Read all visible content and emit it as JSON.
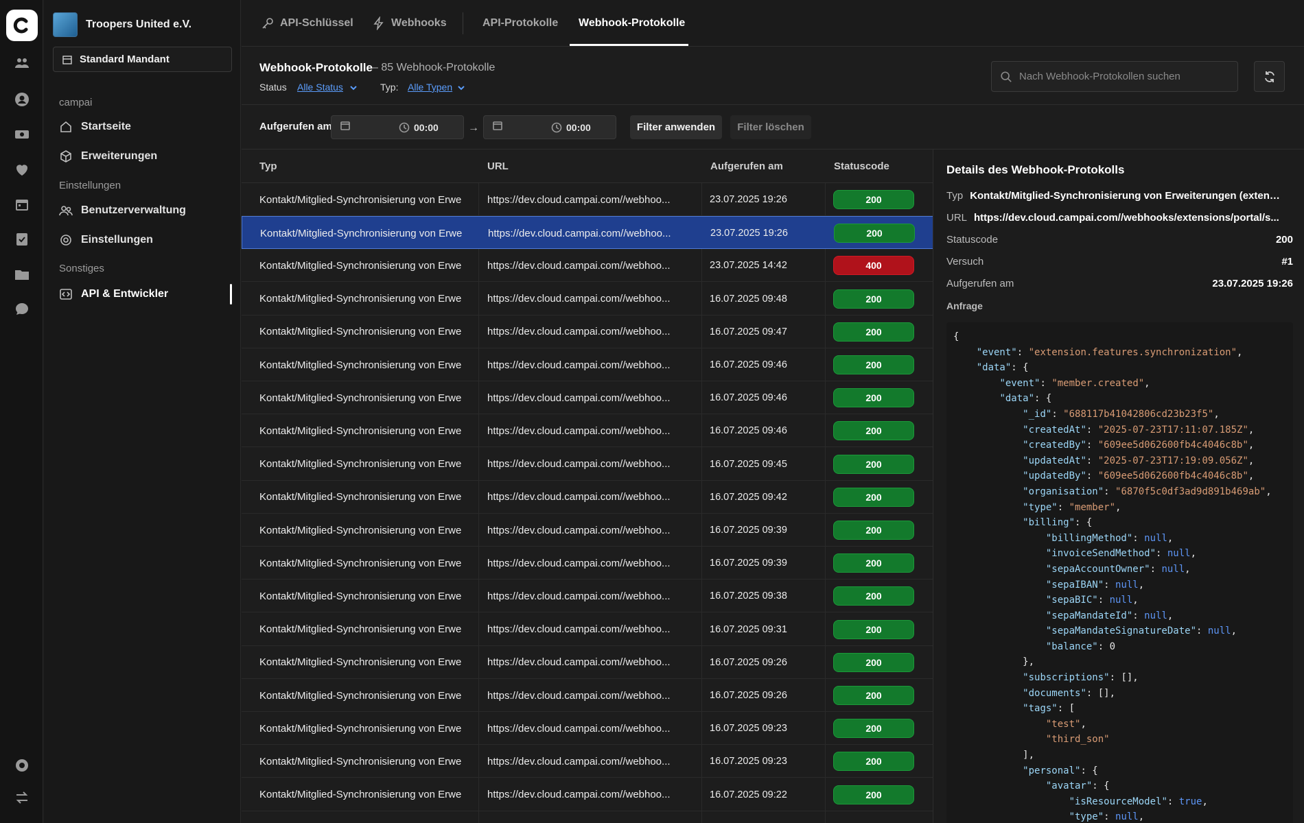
{
  "rail": {
    "items": [
      "logo",
      "members",
      "profile",
      "finance",
      "donations",
      "calendar",
      "tasks",
      "files",
      "chat",
      "settings",
      "switch"
    ]
  },
  "sidebar": {
    "org_name": "Troopers United e.V.",
    "tenant": "Standard Mandant",
    "sections": [
      {
        "label": "campai",
        "items": [
          "Startseite",
          "Erweiterungen"
        ]
      },
      {
        "label": "Einstellungen",
        "items": [
          "Benutzerverwaltung",
          "Einstellungen"
        ]
      },
      {
        "label": "Sonstiges",
        "items": [
          "API & Entwickler"
        ]
      }
    ]
  },
  "tabs": [
    {
      "label": "API-Schlüssel"
    },
    {
      "label": "Webhooks"
    },
    {
      "label": "API-Protokolle"
    },
    {
      "label": "Webhook-Protokolle",
      "active": true
    }
  ],
  "header": {
    "title": "Webhook-Protokolle",
    "count": "– 85 Webhook-Protokolle",
    "status_label": "Status",
    "status_value": "Alle Status",
    "type_label": "Typ:",
    "type_value": "Alle Typen",
    "search_placeholder": "Nach Webhook-Protokollen suchen"
  },
  "datebar": {
    "label": "Aufgerufen am",
    "from_time": "00:00",
    "to_time": "00:00",
    "arrow": "→",
    "apply": "Filter anwenden",
    "clear": "Filter löschen"
  },
  "table": {
    "columns": [
      "Typ",
      "URL",
      "Aufgerufen am",
      "Statuscode"
    ],
    "rows": [
      {
        "type": "Kontakt/Mitglied-Synchronisierung von Erwe",
        "url": "https://dev.cloud.campai.com//webhoo...",
        "date": "23.07.2025 19:26",
        "code": "200"
      },
      {
        "type": "Kontakt/Mitglied-Synchronisierung von Erwe",
        "url": "https://dev.cloud.campai.com//webhoo...",
        "date": "23.07.2025 19:26",
        "code": "200",
        "selected": true
      },
      {
        "type": "Kontakt/Mitglied-Synchronisierung von Erwe",
        "url": "https://dev.cloud.campai.com//webhoo...",
        "date": "23.07.2025 14:42",
        "code": "400"
      },
      {
        "type": "Kontakt/Mitglied-Synchronisierung von Erwe",
        "url": "https://dev.cloud.campai.com//webhoo...",
        "date": "16.07.2025 09:48",
        "code": "200"
      },
      {
        "type": "Kontakt/Mitglied-Synchronisierung von Erwe",
        "url": "https://dev.cloud.campai.com//webhoo...",
        "date": "16.07.2025 09:47",
        "code": "200"
      },
      {
        "type": "Kontakt/Mitglied-Synchronisierung von Erwe",
        "url": "https://dev.cloud.campai.com//webhoo...",
        "date": "16.07.2025 09:46",
        "code": "200"
      },
      {
        "type": "Kontakt/Mitglied-Synchronisierung von Erwe",
        "url": "https://dev.cloud.campai.com//webhoo...",
        "date": "16.07.2025 09:46",
        "code": "200"
      },
      {
        "type": "Kontakt/Mitglied-Synchronisierung von Erwe",
        "url": "https://dev.cloud.campai.com//webhoo...",
        "date": "16.07.2025 09:46",
        "code": "200"
      },
      {
        "type": "Kontakt/Mitglied-Synchronisierung von Erwe",
        "url": "https://dev.cloud.campai.com//webhoo...",
        "date": "16.07.2025 09:45",
        "code": "200"
      },
      {
        "type": "Kontakt/Mitglied-Synchronisierung von Erwe",
        "url": "https://dev.cloud.campai.com//webhoo...",
        "date": "16.07.2025 09:42",
        "code": "200"
      },
      {
        "type": "Kontakt/Mitglied-Synchronisierung von Erwe",
        "url": "https://dev.cloud.campai.com//webhoo...",
        "date": "16.07.2025 09:39",
        "code": "200"
      },
      {
        "type": "Kontakt/Mitglied-Synchronisierung von Erwe",
        "url": "https://dev.cloud.campai.com//webhoo...",
        "date": "16.07.2025 09:39",
        "code": "200"
      },
      {
        "type": "Kontakt/Mitglied-Synchronisierung von Erwe",
        "url": "https://dev.cloud.campai.com//webhoo...",
        "date": "16.07.2025 09:38",
        "code": "200"
      },
      {
        "type": "Kontakt/Mitglied-Synchronisierung von Erwe",
        "url": "https://dev.cloud.campai.com//webhoo...",
        "date": "16.07.2025 09:31",
        "code": "200"
      },
      {
        "type": "Kontakt/Mitglied-Synchronisierung von Erwe",
        "url": "https://dev.cloud.campai.com//webhoo...",
        "date": "16.07.2025 09:26",
        "code": "200"
      },
      {
        "type": "Kontakt/Mitglied-Synchronisierung von Erwe",
        "url": "https://dev.cloud.campai.com//webhoo...",
        "date": "16.07.2025 09:26",
        "code": "200"
      },
      {
        "type": "Kontakt/Mitglied-Synchronisierung von Erwe",
        "url": "https://dev.cloud.campai.com//webhoo...",
        "date": "16.07.2025 09:23",
        "code": "200"
      },
      {
        "type": "Kontakt/Mitglied-Synchronisierung von Erwe",
        "url": "https://dev.cloud.campai.com//webhoo...",
        "date": "16.07.2025 09:23",
        "code": "200"
      },
      {
        "type": "Kontakt/Mitglied-Synchronisierung von Erwe",
        "url": "https://dev.cloud.campai.com//webhoo...",
        "date": "16.07.2025 09:22",
        "code": "200"
      }
    ]
  },
  "detail": {
    "title": "Details des Webhook-Protokolls",
    "type_key": "Typ",
    "type_value": "Kontakt/Mitglied-Synchronisierung von Erweiterungen (extensi...",
    "url_key": "URL",
    "url_value": "https://dev.cloud.campai.com//webhooks/extensions/portal/s...",
    "status_key": "Statuscode",
    "status_value": "200",
    "attempt_key": "Versuch",
    "attempt_value": "#1",
    "called_key": "Aufgerufen am",
    "called_value": "23.07.2025 19:26",
    "request_label": "Anfrage",
    "code_lines": [
      [
        [
          "p",
          "{"
        ]
      ],
      [
        [
          "p",
          "    "
        ],
        [
          "k",
          "\"event\""
        ],
        [
          "p",
          ": "
        ],
        [
          "s",
          "\"extension.features.synchronization\""
        ],
        [
          "p",
          ","
        ]
      ],
      [
        [
          "p",
          "    "
        ],
        [
          "k",
          "\"data\""
        ],
        [
          "p",
          ": {"
        ]
      ],
      [
        [
          "p",
          "        "
        ],
        [
          "k",
          "\"event\""
        ],
        [
          "p",
          ": "
        ],
        [
          "s",
          "\"member.created\""
        ],
        [
          "p",
          ","
        ]
      ],
      [
        [
          "p",
          "        "
        ],
        [
          "k",
          "\"data\""
        ],
        [
          "p",
          ": {"
        ]
      ],
      [
        [
          "p",
          "            "
        ],
        [
          "k",
          "\"_id\""
        ],
        [
          "p",
          ": "
        ],
        [
          "s",
          "\"688117b41042806cd23b23f5\""
        ],
        [
          "p",
          ","
        ]
      ],
      [
        [
          "p",
          "            "
        ],
        [
          "k",
          "\"createdAt\""
        ],
        [
          "p",
          ": "
        ],
        [
          "s",
          "\"2025-07-23T17:11:07.185Z\""
        ],
        [
          "p",
          ","
        ]
      ],
      [
        [
          "p",
          "            "
        ],
        [
          "k",
          "\"createdBy\""
        ],
        [
          "p",
          ": "
        ],
        [
          "s",
          "\"609ee5d062600fb4c4046c8b\""
        ],
        [
          "p",
          ","
        ]
      ],
      [
        [
          "p",
          "            "
        ],
        [
          "k",
          "\"updatedAt\""
        ],
        [
          "p",
          ": "
        ],
        [
          "s",
          "\"2025-07-23T17:19:09.056Z\""
        ],
        [
          "p",
          ","
        ]
      ],
      [
        [
          "p",
          "            "
        ],
        [
          "k",
          "\"updatedBy\""
        ],
        [
          "p",
          ": "
        ],
        [
          "s",
          "\"609ee5d062600fb4c4046c8b\""
        ],
        [
          "p",
          ","
        ]
      ],
      [
        [
          "p",
          "            "
        ],
        [
          "k",
          "\"organisation\""
        ],
        [
          "p",
          ": "
        ],
        [
          "s",
          "\"6870f5c0df3ad9d891b469ab\""
        ],
        [
          "p",
          ","
        ]
      ],
      [
        [
          "p",
          "            "
        ],
        [
          "k",
          "\"type\""
        ],
        [
          "p",
          ": "
        ],
        [
          "s",
          "\"member\""
        ],
        [
          "p",
          ","
        ]
      ],
      [
        [
          "p",
          "            "
        ],
        [
          "k",
          "\"billing\""
        ],
        [
          "p",
          ": {"
        ]
      ],
      [
        [
          "p",
          "                "
        ],
        [
          "k",
          "\"billingMethod\""
        ],
        [
          "p",
          ": "
        ],
        [
          "n",
          "null"
        ],
        [
          "p",
          ","
        ]
      ],
      [
        [
          "p",
          "                "
        ],
        [
          "k",
          "\"invoiceSendMethod\""
        ],
        [
          "p",
          ": "
        ],
        [
          "n",
          "null"
        ],
        [
          "p",
          ","
        ]
      ],
      [
        [
          "p",
          "                "
        ],
        [
          "k",
          "\"sepaAccountOwner\""
        ],
        [
          "p",
          ": "
        ],
        [
          "n",
          "null"
        ],
        [
          "p",
          ","
        ]
      ],
      [
        [
          "p",
          "                "
        ],
        [
          "k",
          "\"sepaIBAN\""
        ],
        [
          "p",
          ": "
        ],
        [
          "n",
          "null"
        ],
        [
          "p",
          ","
        ]
      ],
      [
        [
          "p",
          "                "
        ],
        [
          "k",
          "\"sepaBIC\""
        ],
        [
          "p",
          ": "
        ],
        [
          "n",
          "null"
        ],
        [
          "p",
          ","
        ]
      ],
      [
        [
          "p",
          "                "
        ],
        [
          "k",
          "\"sepaMandateId\""
        ],
        [
          "p",
          ": "
        ],
        [
          "n",
          "null"
        ],
        [
          "p",
          ","
        ]
      ],
      [
        [
          "p",
          "                "
        ],
        [
          "k",
          "\"sepaMandateSignatureDate\""
        ],
        [
          "p",
          ": "
        ],
        [
          "n",
          "null"
        ],
        [
          "p",
          ","
        ]
      ],
      [
        [
          "p",
          "                "
        ],
        [
          "k",
          "\"balance\""
        ],
        [
          "p",
          ": 0"
        ]
      ],
      [
        [
          "p",
          "            },"
        ]
      ],
      [
        [
          "p",
          "            "
        ],
        [
          "k",
          "\"subscriptions\""
        ],
        [
          "p",
          ": [],"
        ]
      ],
      [
        [
          "p",
          "            "
        ],
        [
          "k",
          "\"documents\""
        ],
        [
          "p",
          ": [],"
        ]
      ],
      [
        [
          "p",
          "            "
        ],
        [
          "k",
          "\"tags\""
        ],
        [
          "p",
          ": ["
        ]
      ],
      [
        [
          "p",
          "                "
        ],
        [
          "s",
          "\"test\""
        ],
        [
          "p",
          ","
        ]
      ],
      [
        [
          "p",
          "                "
        ],
        [
          "s",
          "\"third_son\""
        ]
      ],
      [
        [
          "p",
          "            ],"
        ]
      ],
      [
        [
          "p",
          "            "
        ],
        [
          "k",
          "\"personal\""
        ],
        [
          "p",
          ": {"
        ]
      ],
      [
        [
          "p",
          "                "
        ],
        [
          "k",
          "\"avatar\""
        ],
        [
          "p",
          ": {"
        ]
      ],
      [
        [
          "p",
          "                    "
        ],
        [
          "k",
          "\"isResourceModel\""
        ],
        [
          "p",
          ": "
        ],
        [
          "n",
          "true"
        ],
        [
          "p",
          ","
        ]
      ],
      [
        [
          "p",
          "                    "
        ],
        [
          "k",
          "\"type\""
        ],
        [
          "p",
          ": "
        ],
        [
          "n",
          "null"
        ],
        [
          "p",
          ","
        ]
      ]
    ]
  }
}
